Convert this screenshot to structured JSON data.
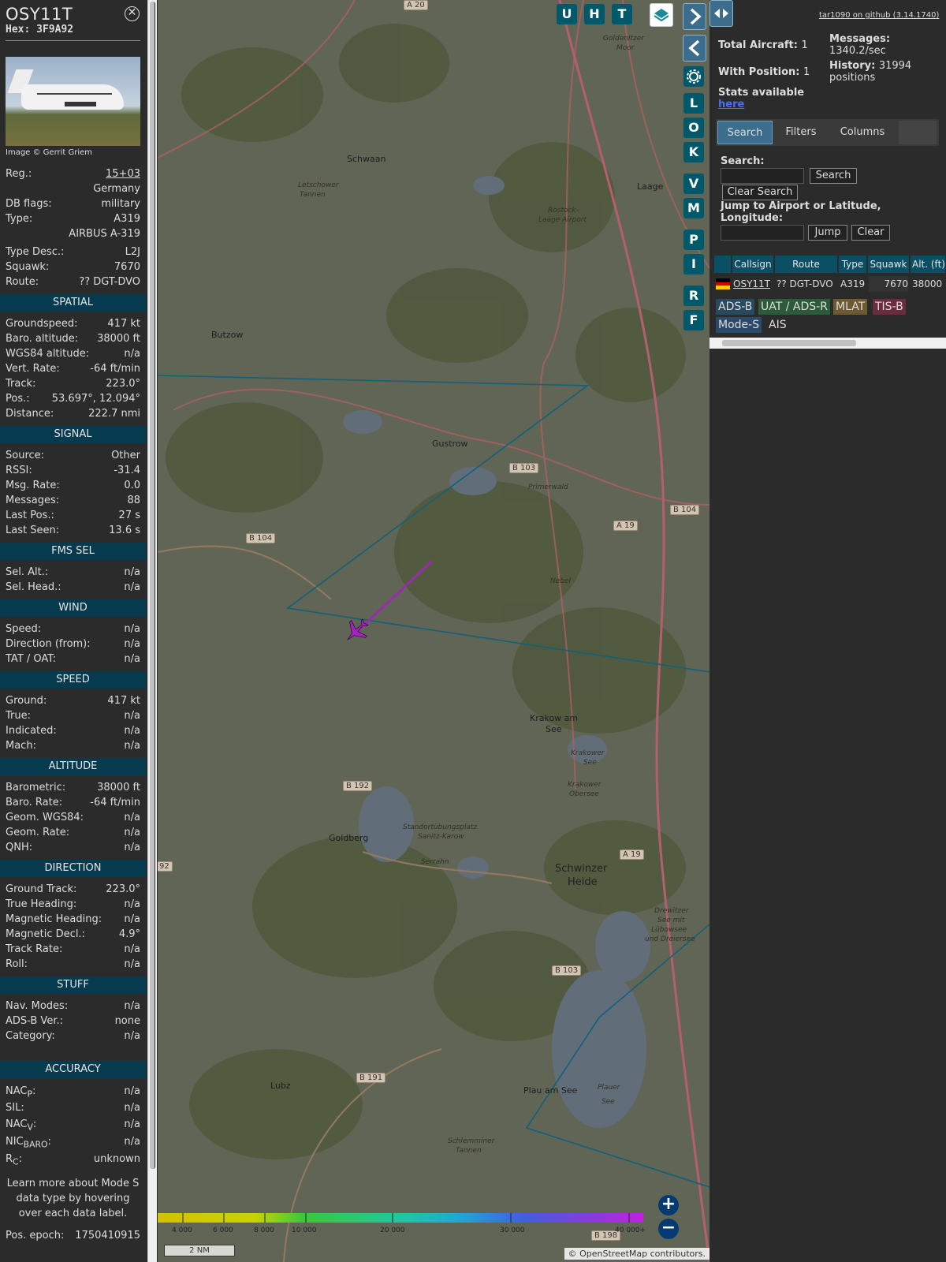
{
  "aircraft": {
    "callsign": "OSY11T",
    "hex": "Hex: 3F9A92",
    "image_credit": "Image © Gerrit Griem"
  },
  "info": {
    "reg_label": "Reg.:",
    "reg": "15+03",
    "country": "Germany",
    "dbflags_label": "DB flags:",
    "dbflags": "military",
    "type_label": "Type:",
    "type": "A319",
    "type_full": "AIRBUS A-319",
    "typedesc_label": "Type Desc.:",
    "typedesc": "L2J",
    "squawk_label": "Squawk:",
    "squawk": "7670",
    "route_label": "Route:",
    "route": "?? DGT-DVO"
  },
  "sections": [
    {
      "title": "SPATIAL",
      "rows": [
        [
          "Groundspeed:",
          "417 kt"
        ],
        [
          "Baro. altitude:",
          "38000 ft"
        ],
        [
          "WGS84 altitude:",
          "n/a"
        ],
        [
          "Vert. Rate:",
          "-64 ft/min"
        ],
        [
          "Track:",
          "223.0°"
        ],
        [
          "Pos.:",
          "53.697°, 12.094°"
        ],
        [
          "Distance:",
          "222.7 nmi"
        ]
      ]
    },
    {
      "title": "SIGNAL",
      "rows": [
        [
          "Source:",
          "Other"
        ],
        [
          "RSSI:",
          "-31.4"
        ],
        [
          "Msg. Rate:",
          "0.0"
        ],
        [
          "Messages:",
          "88"
        ],
        [
          "Last Pos.:",
          "27 s"
        ],
        [
          "Last Seen:",
          "13.6 s"
        ]
      ]
    },
    {
      "title": "FMS SEL",
      "rows": [
        [
          "Sel. Alt.:",
          "n/a"
        ],
        [
          "Sel. Head.:",
          "n/a"
        ]
      ]
    },
    {
      "title": "WIND",
      "rows": [
        [
          "Speed:",
          "n/a"
        ],
        [
          "Direction (from):",
          "n/a"
        ],
        [
          "TAT / OAT:",
          "n/a"
        ]
      ]
    },
    {
      "title": "SPEED",
      "rows": [
        [
          "Ground:",
          "417 kt"
        ],
        [
          "True:",
          "n/a"
        ],
        [
          "Indicated:",
          "n/a"
        ],
        [
          "Mach:",
          "n/a"
        ]
      ]
    },
    {
      "title": "ALTITUDE",
      "rows": [
        [
          "Barometric:",
          "38000 ft"
        ],
        [
          "Baro. Rate:",
          "-64 ft/min"
        ],
        [
          "Geom. WGS84:",
          "n/a"
        ],
        [
          "Geom. Rate:",
          "n/a"
        ],
        [
          "QNH:",
          "n/a"
        ]
      ]
    },
    {
      "title": "DIRECTION",
      "rows": [
        [
          "Ground Track:",
          "223.0°"
        ],
        [
          "True Heading:",
          "n/a"
        ],
        [
          "Magnetic Heading:",
          "n/a"
        ],
        [
          "Magnetic Decl.:",
          "4.9°"
        ],
        [
          "Track Rate:",
          "n/a"
        ],
        [
          "Roll:",
          "n/a"
        ]
      ]
    },
    {
      "title": "STUFF",
      "rows": [
        [
          "Nav. Modes:",
          "n/a"
        ],
        [
          "ADS-B Ver.:",
          "none"
        ],
        [
          "Category:",
          "n/a"
        ]
      ]
    }
  ],
  "accuracy": {
    "title": "ACCURACY",
    "nacp": "NAC",
    "nacp_sub": "P",
    "nacp_v": "n/a",
    "sil": "SIL:",
    "sil_v": "n/a",
    "nacv": "NAC",
    "nacv_sub": "V",
    "nacv_v": "n/a",
    "nic": "NIC",
    "nic_sub": "BARO",
    "nic_v": "n/a",
    "rc": "R",
    "rc_sub": "C",
    "rc_v": "unknown"
  },
  "note": "Learn more about Mode S data type by hovering over each data label.",
  "epoch": {
    "label": "Pos. epoch:",
    "value": "1750410915"
  },
  "map": {
    "buttons": [
      "U",
      "H",
      "T",
      "L",
      "O",
      "K",
      "V",
      "M",
      "P",
      "I",
      "R",
      "F"
    ],
    "places": [
      "Schwaan",
      "Laage",
      "Butzow",
      "Gustrow",
      "Krakow am",
      "See",
      "Goldberg",
      "Lubz",
      "Plau am See",
      "Schwinzer",
      "Heide"
    ],
    "italic_places": [
      "Letschower",
      "Tannen",
      "Goldenitzer",
      "Moor",
      "Rostock-",
      "Laage Airport",
      "Primerwald",
      "Nebel",
      "Krakower",
      "See",
      "Krakower",
      "Obersee",
      "Standortübungsplatz",
      "Sanitz-Karow",
      "Serrahn",
      "Drewitzer",
      "See mit",
      "Lübowsee",
      "und Dreiersee",
      "Plauer",
      "See",
      "Schlemminer",
      "Tannen"
    ],
    "roads": [
      "A 20",
      "B 103",
      "B 104",
      "A 19",
      "B 104",
      "B 192",
      "A 19",
      "B 103",
      "B 191",
      "B 198",
      "92"
    ],
    "legend": [
      "4 000",
      "6 000",
      "8 000",
      "10 000",
      "20 000",
      "30 000",
      "40 000+"
    ],
    "scale": "2 NM",
    "attribution": "© OpenStreetMap contributors.",
    "zoom_in": "+",
    "zoom_out": "−"
  },
  "right": {
    "github": "tar1090 on github (3.14.1740)",
    "total_label": "Total Aircraft:",
    "total": "1",
    "withpos_label": "With Position:",
    "withpos": "1",
    "messages_label": "Messages:",
    "messages": "1340.2/sec",
    "history_label": "History:",
    "history": "31994",
    "history_unit": "positions",
    "stats": "Stats available",
    "here": "here",
    "tabs": [
      "Search",
      "Filters",
      "Columns"
    ],
    "search_label": "Search:",
    "search_btn": "Search",
    "clear_search": "Clear Search",
    "jump_label": "Jump to Airport or Latitude, Longitude:",
    "jump_btn": "Jump",
    "clear_btn": "Clear",
    "columns": [
      "Callsign",
      "Route",
      "Type",
      "Squawk",
      "Alt. (ft)"
    ],
    "row": {
      "callsign": "OSY11T",
      "route": "?? DGT-DVO",
      "type": "A319",
      "squawk": "7670",
      "alt": "38000"
    },
    "sources": [
      "ADS-B",
      "UAT / ADS-R",
      "MLAT",
      "TIS-B",
      "Mode-S",
      "AIS"
    ]
  },
  "colors": {
    "section": "#063a4f",
    "header": "#0a4f63",
    "button": "#00596b",
    "track": "#c020e0",
    "range": "#0a6d8a"
  }
}
